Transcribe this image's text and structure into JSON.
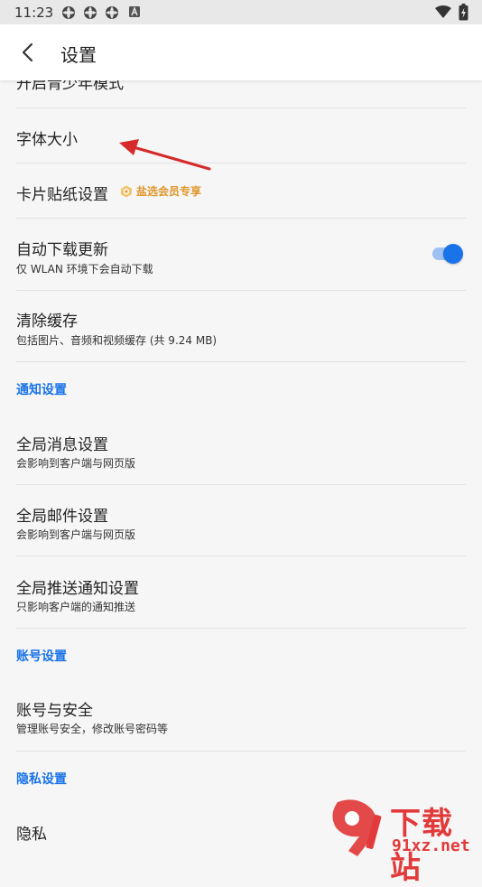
{
  "status_bar": {
    "time": "11:23"
  },
  "app_bar": {
    "title": "设置"
  },
  "settings": {
    "teen_mode": {
      "title": "开启青少年模式"
    },
    "font_size": {
      "title": "字体大小"
    },
    "card_sticker": {
      "title": "卡片贴纸设置",
      "badge": "盐选会员专享"
    },
    "auto_update": {
      "title": "自动下载更新",
      "subtitle": "仅 WLAN 环境下会自动下载",
      "enabled": true
    },
    "clear_cache": {
      "title": "清除缓存",
      "subtitle": "包括图片、音频和视频缓存 (共 9.24 MB)"
    }
  },
  "sections": {
    "notification": "通知设置",
    "account": "账号设置",
    "privacy": "隐私设置"
  },
  "notification_items": [
    {
      "title": "全局消息设置",
      "subtitle": "会影响到客户端与网页版"
    },
    {
      "title": "全局邮件设置",
      "subtitle": "会影响到客户端与网页版"
    },
    {
      "title": "全局推送通知设置",
      "subtitle": "只影响客户端的通知推送"
    }
  ],
  "account_items": [
    {
      "title": "账号与安全",
      "subtitle": "管理账号安全，修改账号密码等"
    }
  ],
  "privacy_items": [
    {
      "title": "隐私"
    }
  ],
  "watermark": {
    "text": "下载站",
    "url_text": "91xz.net",
    "logo_text": "91"
  },
  "colors": {
    "accent": "#1a73e8",
    "badge": "#e0962a",
    "annotation_arrow": "#d62a2a"
  },
  "icons": {
    "back": "back-arrow-icon",
    "badge": "vip-badge-icon"
  }
}
